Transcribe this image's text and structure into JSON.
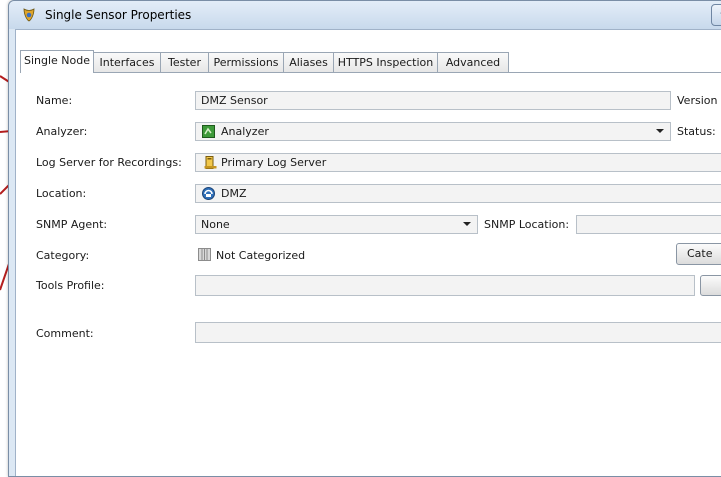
{
  "window": {
    "title": "Single Sensor Properties",
    "title_button": "-"
  },
  "tabs": [
    "Single Node",
    "Interfaces",
    "Tester",
    "Permissions",
    "Aliases",
    "HTTPS Inspection",
    "Advanced"
  ],
  "form": {
    "name_label": "Name:",
    "name_value": "DMZ Sensor",
    "version_label": "Version",
    "analyzer_label": "Analyzer:",
    "analyzer_value": "Analyzer",
    "analyzer_icon": "analyzer-icon",
    "status_label": "Status:",
    "log_server_label": "Log Server for Recordings:",
    "log_server_value": "Primary Log Server",
    "log_server_icon": "log-server-icon",
    "location_label": "Location:",
    "location_value": "DMZ",
    "location_icon": "location-icon",
    "snmp_agent_label": "SNMP Agent:",
    "snmp_agent_value": "None",
    "snmp_location_label": "SNMP Location:",
    "snmp_location_value": "",
    "category_label": "Category:",
    "category_value": "Not Categorized",
    "category_icon": "category-icon",
    "category_button": "Cate",
    "tools_profile_label": "Tools Profile:",
    "tools_profile_value": "",
    "comment_label": "Comment:",
    "comment_value": ""
  },
  "colors": {
    "callout": "#b41e1e",
    "window_frame": "#dce8f4"
  }
}
